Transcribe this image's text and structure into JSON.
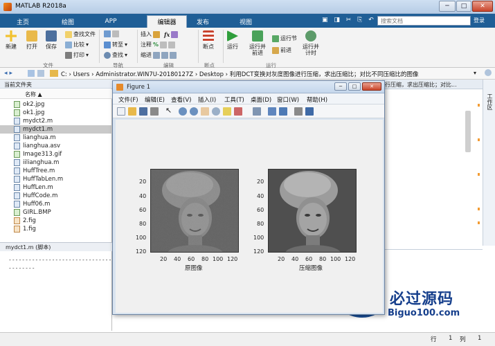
{
  "app": {
    "title": "MATLAB R2018a"
  },
  "tabs": [
    "主页",
    "绘图",
    "APP",
    "编辑器",
    "发布",
    "视图"
  ],
  "active_tab": "编辑器",
  "search": {
    "placeholder": "搜索文档"
  },
  "login": "登录",
  "ribbon": {
    "file": {
      "new": "新建",
      "open": "打开",
      "save": "保存",
      "find_files": "查找文件",
      "compare": "比较",
      "print": "打印",
      "section": "文件"
    },
    "nav": {
      "goto": "转至",
      "find": "查找",
      "section": "导航"
    },
    "edit": {
      "insert": "插入",
      "comment": "注释",
      "indent": "缩进",
      "section": "编辑"
    },
    "breakpoints": {
      "label": "断点",
      "section": "断点"
    },
    "run": {
      "run": "运行",
      "run_advance": "运行并\n前进",
      "run_section": "运行节",
      "advance": "前进",
      "run_time": "运行并\n计时",
      "section": "运行"
    }
  },
  "address": {
    "path": "C: › Users › Administrator.WIN7U-20180127Z › Desktop › 利用DCT变换对灰度图像进行压缩，求出压缩比；对比不同压缩比的图像"
  },
  "filepane": {
    "header": "当前文件夹",
    "col_name": "名称 ▲",
    "files": [
      {
        "name": "ok2.jpg",
        "type": "img"
      },
      {
        "name": "ok1.jpg",
        "type": "img"
      },
      {
        "name": "mydct2.m",
        "type": "m"
      },
      {
        "name": "mydct1.m",
        "type": "m",
        "selected": true
      },
      {
        "name": "lianghua.m",
        "type": "m"
      },
      {
        "name": "lianghua.asv",
        "type": "asv"
      },
      {
        "name": "Image313.gif",
        "type": "img"
      },
      {
        "name": "iilianghua.m",
        "type": "m"
      },
      {
        "name": "HuffTree.m",
        "type": "m"
      },
      {
        "name": "HuffTabLen.m",
        "type": "m"
      },
      {
        "name": "HuffLen.m",
        "type": "m"
      },
      {
        "name": "HuffCode.m",
        "type": "m"
      },
      {
        "name": "Huff06.m",
        "type": "m"
      },
      {
        "name": "GIRL.BMP",
        "type": "img"
      },
      {
        "name": "2.fig",
        "type": "fig"
      },
      {
        "name": "1.fig",
        "type": "fig"
      }
    ],
    "details_title": "mydct1.m  (脚本)",
    "details_lines": [
      "------------------------------------------------------------",
      "--------"
    ]
  },
  "editor": {
    "title": "行压缩，求出压缩比；对比..."
  },
  "side_panel": {
    "label": "工作区"
  },
  "status": {
    "row_label": "行",
    "row_value": "1",
    "col_label": "列",
    "col_value": "1"
  },
  "figure": {
    "title": "Figure 1",
    "menu": [
      "文件(F)",
      "编辑(E)",
      "查看(V)",
      "插入(I)",
      "工具(T)",
      "桌面(D)",
      "窗口(W)",
      "帮助(H)"
    ],
    "plots": [
      {
        "title": "原图像",
        "xticks": [
          "20",
          "40",
          "60",
          "80",
          "100",
          "120"
        ],
        "yticks": [
          "20",
          "40",
          "60",
          "80",
          "100",
          "120"
        ]
      },
      {
        "title": "压缩图像",
        "xticks": [
          "20",
          "40",
          "60",
          "80",
          "100",
          "120"
        ],
        "yticks": [
          "20",
          "40",
          "60",
          "80",
          "100",
          "120"
        ]
      }
    ]
  },
  "watermark": {
    "cn": "必过源码",
    "en": "Biguo100.com"
  }
}
